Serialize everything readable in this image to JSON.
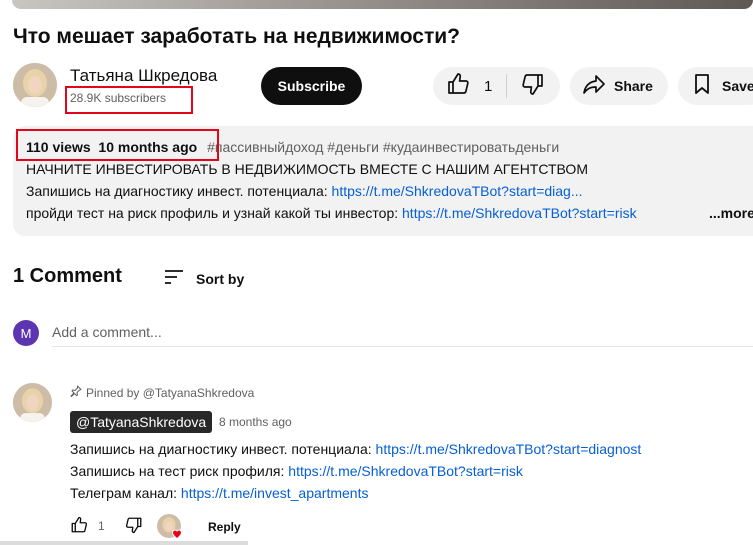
{
  "video": {
    "title": "Что мешает заработать на недвижимости?"
  },
  "channel": {
    "name": "Татьяна Шкредова",
    "subscribers": "28.9K subscribers",
    "subscribe_label": "Subscribe"
  },
  "actions": {
    "like_count": "1",
    "share_label": "Share",
    "save_label": "Save"
  },
  "description": {
    "views": "110 views",
    "age": "10 months ago",
    "hashtags": "#пассивныйдоход #деньги #кудаинвестироватьденьги",
    "line1": "НАЧНИТЕ ИНВЕСТИРОВАТЬ В НЕДВИЖИМОСТЬ ВМЕСТЕ С НАШИМ АГЕНТСТВОМ",
    "line2_text": "Запишись на диагностику инвест. потенциала: ",
    "line2_link": "https://t.me/ShkredovaTBot?start=diag...",
    "line3_text": "пройди тест на риск профиль и узнай какой ты инвестор: ",
    "line3_link": "https://t.me/ShkredovaTBot?start=risk",
    "more_label": "...more"
  },
  "comments": {
    "count_label": "1 Comment",
    "sort_label": "Sort by",
    "user_initial": "M",
    "add_placeholder": "Add a comment...",
    "items": [
      {
        "pinned_label": "Pinned by @TatyanaShkredova",
        "author": "@TatyanaShkredova",
        "age": "8 months ago",
        "lines": [
          {
            "text": "Запишись на диагностику инвест. потенциала: ",
            "link": "https://t.me/ShkredovaTBot?start=diagnost"
          },
          {
            "text": "Запишись на тест риск профиля: ",
            "link": "https://t.me/ShkredovaTBot?start=risk"
          },
          {
            "text": "Телеграм канал: ",
            "link": "https://t.me/invest_apartments"
          }
        ],
        "like_count": "1",
        "reply_label": "Reply"
      }
    ]
  },
  "colors": {
    "highlight_box": "#e3061a",
    "link": "#065fd4",
    "user_avatar": "#5e35b1"
  }
}
